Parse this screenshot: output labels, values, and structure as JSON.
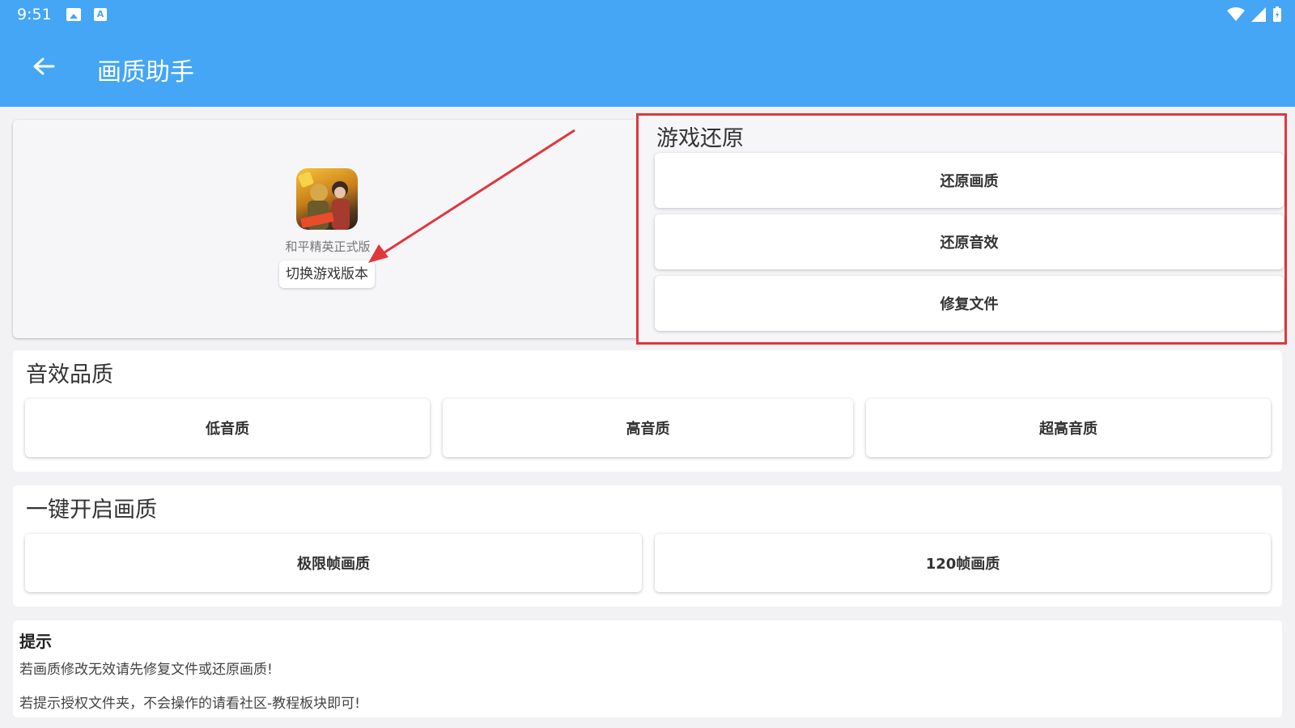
{
  "status_bar": {
    "time": "9:51",
    "icon_a": "A"
  },
  "app_bar": {
    "title": "画质助手"
  },
  "game": {
    "name": "和平精英正式版",
    "switch_label": "切换游戏版本"
  },
  "restore": {
    "title": "游戏还原",
    "buttons": [
      "还原画质",
      "还原音效",
      "修复文件"
    ]
  },
  "audio": {
    "title": "音效品质",
    "buttons": [
      "低音质",
      "高音质",
      "超高音质"
    ]
  },
  "quality": {
    "title": "一键开启画质",
    "buttons": [
      "极限帧画质",
      "120帧画质"
    ]
  },
  "tips": {
    "title": "提示",
    "lines": [
      "若画质修改无效请先修复文件或还原画质!",
      "若提示授权文件夹，不会操作的请看社区-教程板块即可!"
    ]
  },
  "colors": {
    "appbar": "#44a6f5",
    "annotation": "#e0373d"
  }
}
